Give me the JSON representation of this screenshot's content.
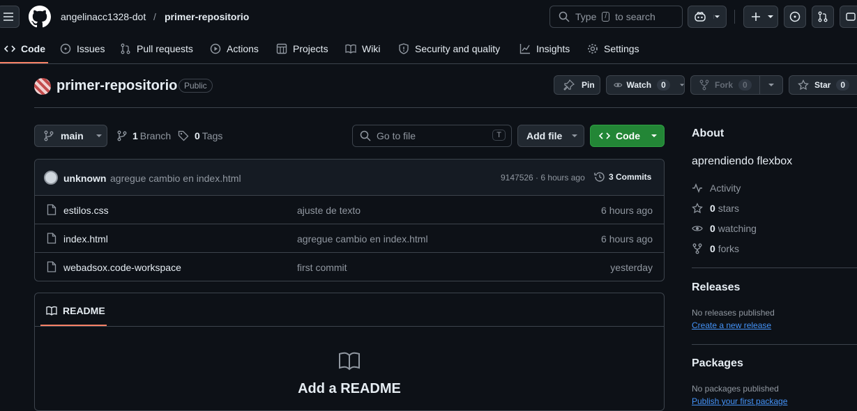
{
  "header": {
    "owner": "angelinacc1328-dot",
    "separator": "/",
    "repo": "primer-repositorio",
    "search_placeholder_pre": "Type",
    "search_key": "/",
    "search_placeholder_post": "to search"
  },
  "tabs": [
    {
      "label": "Code",
      "icon": "code-icon"
    },
    {
      "label": "Issues",
      "icon": "issue-icon"
    },
    {
      "label": "Pull requests",
      "icon": "pull-request-icon"
    },
    {
      "label": "Actions",
      "icon": "play-icon"
    },
    {
      "label": "Projects",
      "icon": "table-icon"
    },
    {
      "label": "Wiki",
      "icon": "book-icon"
    },
    {
      "label": "Security and quality",
      "icon": "shield-icon"
    },
    {
      "label": "Insights",
      "icon": "graph-icon"
    },
    {
      "label": "Settings",
      "icon": "gear-icon"
    }
  ],
  "repo_header": {
    "name": "primer-repositorio",
    "visibility": "Public",
    "pin": "Pin",
    "watch": "Watch",
    "watch_count": "0",
    "fork": "Fork",
    "fork_count": "0",
    "star": "Star",
    "star_count": "0"
  },
  "toolbar": {
    "branch": "main",
    "branch_count": "1",
    "branch_label": "Branch",
    "tag_count": "0",
    "tag_label": "Tags",
    "go_to_file": "Go to file",
    "go_to_file_key": "T",
    "add_file": "Add file",
    "code": "Code"
  },
  "commit": {
    "author": "unknown",
    "message": "agregue cambio en index.html",
    "sha_time": "9147526 · 6 hours ago",
    "commits": "3 Commits"
  },
  "files": [
    {
      "name": "estilos.css",
      "message": "ajuste de texto",
      "time": "6 hours ago"
    },
    {
      "name": "index.html",
      "message": "agregue cambio en index.html",
      "time": "6 hours ago"
    },
    {
      "name": "webadsox.code-workspace",
      "message": "first commit",
      "time": "yesterday"
    }
  ],
  "readme": {
    "tab": "README",
    "heading": "Add a README"
  },
  "about": {
    "title": "About",
    "description": "aprendiendo flexbox",
    "activity": "Activity",
    "stars_n": "0",
    "stars": "stars",
    "watching_n": "0",
    "watching": "watching",
    "forks_n": "0",
    "forks": "forks"
  },
  "releases": {
    "title": "Releases",
    "none": "No releases published",
    "create": "Create a new release"
  },
  "packages": {
    "title": "Packages",
    "none": "No packages published",
    "publish": "Publish your first package"
  },
  "colors": {
    "accent": "#238636",
    "link": "#4493f8",
    "tab_underline": "#f78166"
  }
}
